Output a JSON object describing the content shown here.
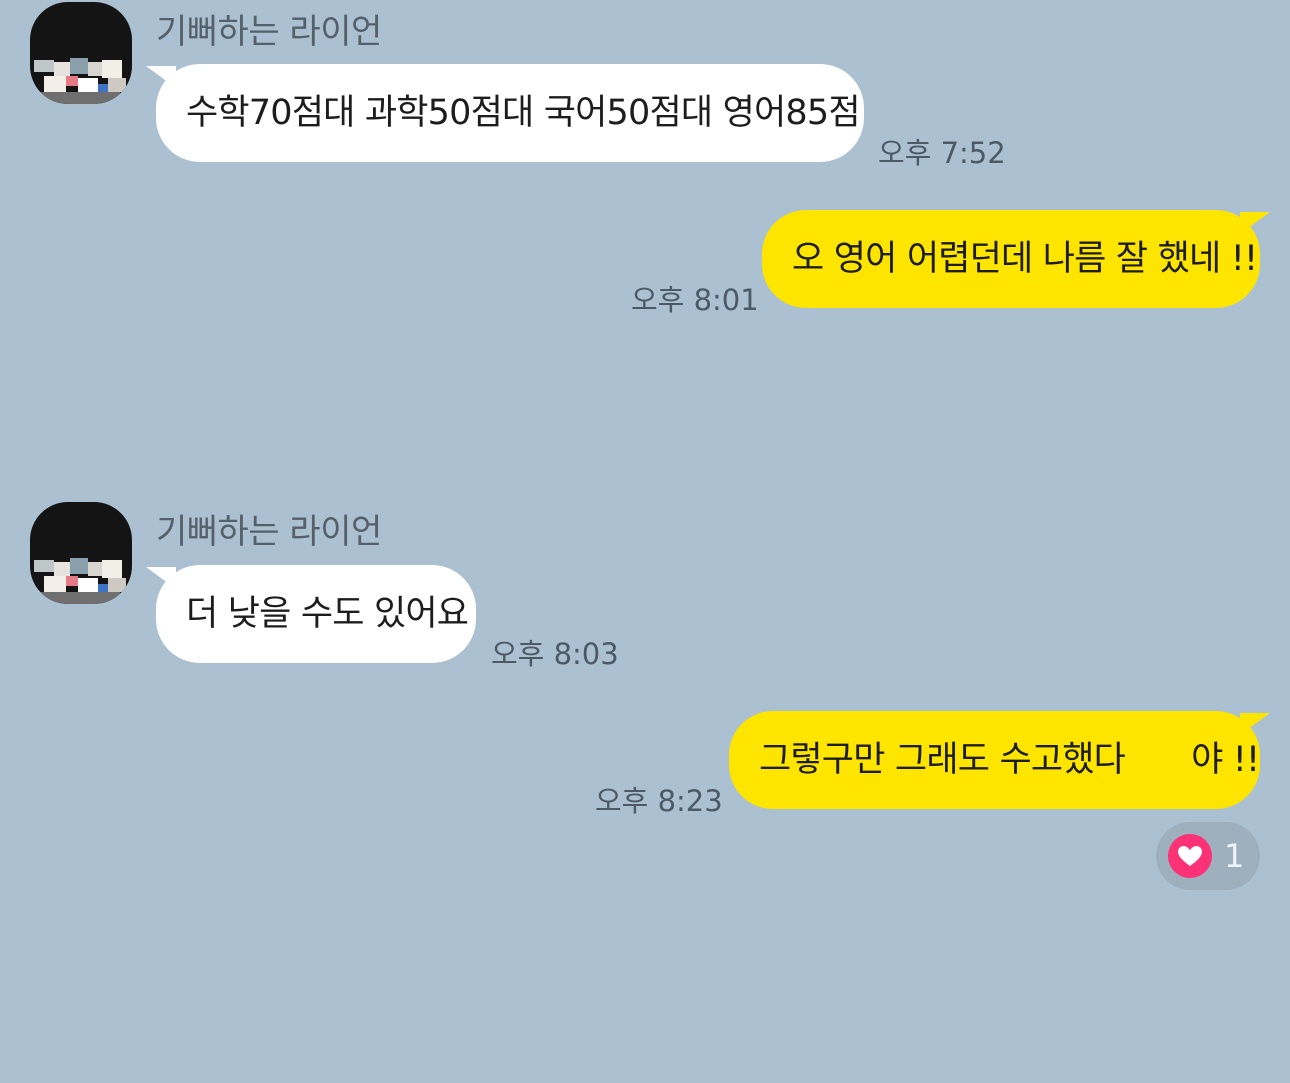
{
  "conversation": {
    "messages": [
      {
        "direction": "incoming",
        "sender": "기뻐하는 라이언",
        "text": "수학70점대 과학50점대 국어50점대 영어85점",
        "time": "오후 7:52"
      },
      {
        "direction": "outgoing",
        "text": "오 영어 어렵던데 나름 잘 했네 !!",
        "time": "오후 8:01"
      },
      {
        "direction": "incoming",
        "sender": "기뻐하는 라이언",
        "text": "더 낮을 수도 있어요",
        "time": "오후 8:03"
      },
      {
        "direction": "outgoing",
        "text_part1": "그렇구만 그래도 수고했다",
        "text_part2": "야 !!",
        "time": "오후 8:23",
        "reaction": {
          "icon": "heart-icon",
          "count": "1"
        }
      }
    ]
  },
  "colors": {
    "background": "#abc1d1",
    "incoming_bubble": "#ffffff",
    "outgoing_bubble": "#fee500",
    "reaction_heart": "#fb3275"
  }
}
